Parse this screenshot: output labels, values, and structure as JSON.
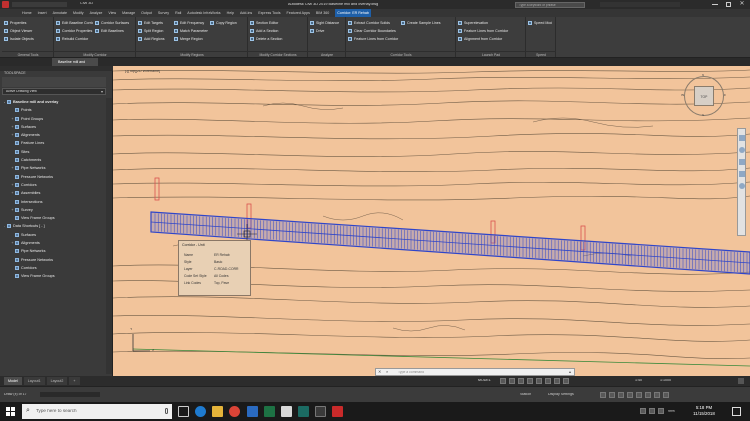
{
  "app": {
    "title": "Autodesk Civil 3D 2019   Baseline mill and overlay.dwg",
    "search_placeholder": "Type a keyword or phrase",
    "quick_access_label": "Civil 3D"
  },
  "menu": {
    "items": [
      "Home",
      "Insert",
      "Annotate",
      "Modify",
      "Analyze",
      "View",
      "Manage",
      "Output",
      "Survey",
      "Rail",
      "Autodesk InfraWorks",
      "Help",
      "Add-ins",
      "Express Tools",
      "Featured Apps",
      "BIM 360",
      "Corridor: ER Rehab"
    ],
    "active_index": 16
  },
  "ribbon": {
    "panels": [
      {
        "title": "General Tools",
        "rows": [
          "Properties",
          "Object Viewer",
          "Isolate Objects"
        ]
      },
      {
        "title": "Modify Corridor",
        "rows": [
          "Edit Baseline Corridor",
          "Corridor Properties",
          "Rebuild Corridor",
          "Corridor Surfaces",
          "Edit Baselines"
        ]
      },
      {
        "title": "Modify Regions",
        "rows": [
          "Edit Targets",
          "Split Region",
          "Add Regions",
          "Edit Frequency",
          "Match Parameters",
          "Merge Region",
          "Copy Region"
        ]
      },
      {
        "title": "Modify Corridor Sections",
        "rows": [
          "Section Editor",
          "Add a Section",
          "Delete a Section"
        ]
      },
      {
        "title": "Analyze",
        "rows": [
          "Sight Distance",
          "Drive"
        ]
      },
      {
        "title": "Corridor Tools",
        "rows": [
          "Extract Corridor Solids",
          "Clear Corridor Boundaries",
          "Feature Lines from Corridor",
          "Create Sample Lines"
        ]
      },
      {
        "title": "Launch Pad",
        "rows": [
          "Superelevation",
          "Feature Lines from Corridor",
          "Alignment from Corridor"
        ]
      },
      {
        "title": "Speed",
        "rows": [
          "Speed Mode"
        ]
      }
    ]
  },
  "doc_tabs": [
    "Start",
    "Baseline mill and overlay*",
    "Export mill 2*",
    "Export mill*",
    "Layout mill",
    "+"
  ],
  "toolspace": {
    "title": "TOOLSPACE",
    "view_dropdown": "Active Drawing View",
    "tree": [
      {
        "label": "Baseline mill and overlay",
        "level": 0,
        "exp": "-",
        "bold": true
      },
      {
        "label": "Points",
        "level": 1,
        "exp": ""
      },
      {
        "label": "Point Groups",
        "level": 1,
        "exp": "+"
      },
      {
        "label": "Surfaces",
        "level": 1,
        "exp": "+"
      },
      {
        "label": "Alignments",
        "level": 1,
        "exp": "+"
      },
      {
        "label": "Feature Lines",
        "level": 1,
        "exp": ""
      },
      {
        "label": "Sites",
        "level": 1,
        "exp": ""
      },
      {
        "label": "Catchments",
        "level": 1,
        "exp": ""
      },
      {
        "label": "Pipe Networks",
        "level": 1,
        "exp": "+"
      },
      {
        "label": "Pressure Networks",
        "level": 1,
        "exp": ""
      },
      {
        "label": "Corridors",
        "level": 1,
        "exp": "+"
      },
      {
        "label": "Assemblies",
        "level": 1,
        "exp": "+"
      },
      {
        "label": "Intersections",
        "level": 1,
        "exp": ""
      },
      {
        "label": "Survey",
        "level": 1,
        "exp": "+"
      },
      {
        "label": "View Frame Groups",
        "level": 1,
        "exp": ""
      },
      {
        "label": "Data Shortcuts [ - ]",
        "level": 0,
        "exp": "-"
      },
      {
        "label": "Surfaces",
        "level": 1,
        "exp": ""
      },
      {
        "label": "Alignments",
        "level": 1,
        "exp": "+"
      },
      {
        "label": "Pipe Networks",
        "level": 1,
        "exp": ""
      },
      {
        "label": "Pressure Networks",
        "level": 1,
        "exp": ""
      },
      {
        "label": "Corridors",
        "level": 1,
        "exp": ""
      },
      {
        "label": "View Frame Groups",
        "level": 1,
        "exp": ""
      }
    ],
    "side_tabs": [
      "Prospector",
      "Settings",
      "Survey",
      "Toolbox"
    ]
  },
  "viewport": {
    "label": "[-][Top][2D Wireframe]",
    "command_placeholder": "Type a command",
    "viewcube_top": "TOP",
    "viewcube_n": "N",
    "viewcube_s": "S",
    "viewcube_w": "W",
    "viewcube_e": "E",
    "ucs_y": "Y",
    "ucs_x": "X"
  },
  "tooltip": {
    "title": "Corridor - Unit",
    "rows": [
      {
        "k": "Name",
        "v": "ER Rehab"
      },
      {
        "k": "Style",
        "v": "Basic"
      },
      {
        "k": "Layer",
        "v": "C-ROAD-CORR"
      },
      {
        "k": "Code Set Style",
        "v": "All Codes"
      },
      {
        "k": "Link Codes",
        "v": "Top, Pave"
      }
    ]
  },
  "layout_tabs": [
    "Model",
    "Layout1",
    "Layout2",
    "+"
  ],
  "status": {
    "left": "Draw (x) of 17",
    "model_label": "MODEL",
    "scale": "1:1000",
    "anno": "1:40",
    "right_a": "Station",
    "right_b": "Display Settings"
  },
  "taskbar": {
    "search_placeholder": "Type here to search",
    "time": "5:18 PM",
    "date": "11/15/2018",
    "tray": "ENG",
    "battery": "99%"
  },
  "colors": {
    "canvas": "#f2c49b",
    "corridor_blue": "#2f45c9",
    "active_tab": "#1e5fa8"
  }
}
